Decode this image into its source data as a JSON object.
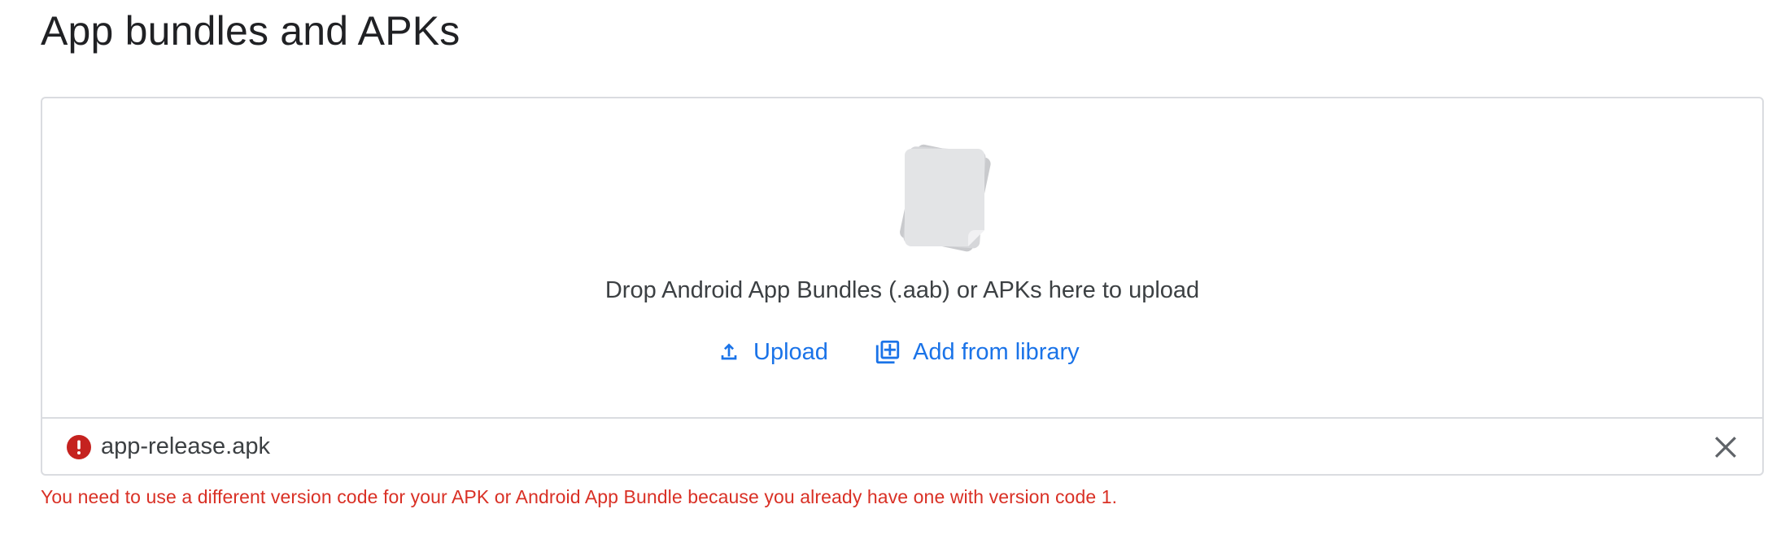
{
  "page": {
    "title": "App bundles and APKs"
  },
  "drop_zone": {
    "illustration_icon": "document-stack-icon",
    "instruction": "Drop Android App Bundles (.aab) or APKs here to upload",
    "actions": [
      {
        "label": "Upload",
        "icon": "upload-icon"
      },
      {
        "label": "Add from library",
        "icon": "library-add-icon"
      }
    ]
  },
  "file": {
    "name": "app-release.apk",
    "status_icon": "error-icon",
    "remove_icon": "close-icon",
    "error_message": "You need to use a different version code for your APK or Android App Bundle because you already have one with version code 1."
  },
  "colors": {
    "accent": "#1a73e8",
    "error": "#d93025",
    "border": "#dadce0",
    "text": "#202124"
  }
}
